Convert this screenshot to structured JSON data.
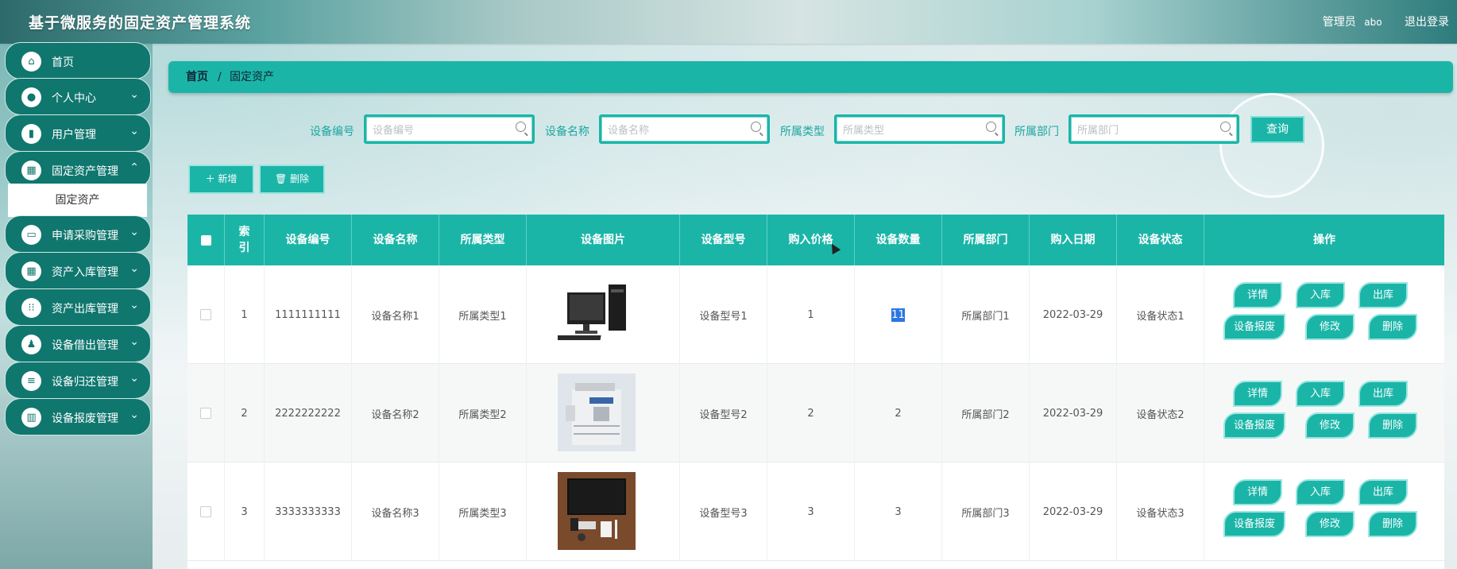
{
  "app": {
    "title": "基于微服务的固定资产管理系统"
  },
  "header": {
    "role": "管理员",
    "username": "abo",
    "logout": "退出登录"
  },
  "sidebar": {
    "items": [
      {
        "label": "首页",
        "icon": "home-icon",
        "expandable": false
      },
      {
        "label": "个人中心",
        "icon": "user-icon",
        "expandable": true
      },
      {
        "label": "用户管理",
        "icon": "book-icon",
        "expandable": true
      },
      {
        "label": "固定资产管理",
        "icon": "grid-icon",
        "expandable": true
      },
      {
        "label": "申请采购管理",
        "icon": "monitor-icon",
        "expandable": true
      },
      {
        "label": "资产入库管理",
        "icon": "grid-icon",
        "expandable": true
      },
      {
        "label": "资产出库管理",
        "icon": "apps-icon",
        "expandable": true
      },
      {
        "label": "设备借出管理",
        "icon": "stamp-icon",
        "expandable": true
      },
      {
        "label": "设备归还管理",
        "icon": "list-icon",
        "expandable": true
      },
      {
        "label": "设备报废管理",
        "icon": "bar-chart-icon",
        "expandable": true
      }
    ],
    "subitem": "固定资产"
  },
  "breadcrumb": {
    "home": "首页",
    "separator": "/",
    "current": "固定资产"
  },
  "search": {
    "fields": [
      {
        "label": "设备编号",
        "placeholder": "设备编号"
      },
      {
        "label": "设备名称",
        "placeholder": "设备名称"
      },
      {
        "label": "所属类型",
        "placeholder": "所属类型"
      },
      {
        "label": "所属部门",
        "placeholder": "所属部门"
      }
    ],
    "query": "查询"
  },
  "actions": {
    "add": "新增",
    "delete": "删除"
  },
  "table": {
    "headers": [
      "索引",
      "设备编号",
      "设备名称",
      "所属类型",
      "设备图片",
      "设备型号",
      "购入价格",
      "设备数量",
      "所属部门",
      "购入日期",
      "设备状态",
      "操作"
    ],
    "rows": [
      {
        "index": "1",
        "code": "1111111111",
        "name": "设备名称1",
        "type": "所属类型1",
        "image": "computer",
        "model": "设备型号1",
        "price": "1",
        "qty": "11",
        "dept": "所属部门1",
        "date": "2022-03-29",
        "status": "设备状态1"
      },
      {
        "index": "2",
        "code": "2222222222",
        "name": "设备名称2",
        "type": "所属类型2",
        "image": "copier",
        "model": "设备型号2",
        "price": "2",
        "qty": "2",
        "dept": "所属部门2",
        "date": "2022-03-29",
        "status": "设备状态2"
      },
      {
        "index": "3",
        "code": "3333333333",
        "name": "设备名称3",
        "type": "所属类型3",
        "image": "desk-setup",
        "model": "设备型号3",
        "price": "3",
        "qty": "3",
        "dept": "所属部门3",
        "date": "2022-03-29",
        "status": "设备状态3"
      }
    ],
    "ops": {
      "detail": "详情",
      "in": "入库",
      "out": "出库",
      "scrap": "设备报废",
      "edit": "修改",
      "remove": "删除"
    }
  },
  "colors": {
    "accent": "#1bb5a8",
    "menu": "#10776f"
  }
}
